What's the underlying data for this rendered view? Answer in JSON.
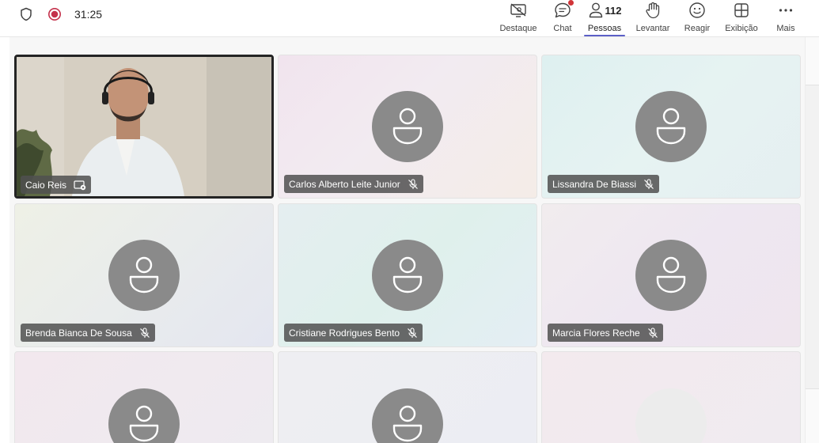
{
  "meeting": {
    "elapsed_time": "31:25"
  },
  "toolbar": {
    "spotlight_label": "Destaque",
    "chat_label": "Chat",
    "people_label": "Pessoas",
    "people_count": "112",
    "raise_label": "Levantar",
    "react_label": "Reagir",
    "view_label": "Exibição",
    "more_label": "Mais"
  },
  "participants": [
    {
      "name": "Caio Reis",
      "video": true,
      "muted": false,
      "pinned": true
    },
    {
      "name": "Carlos Alberto Leite Junior",
      "video": false,
      "muted": true
    },
    {
      "name": "Lissandra De Biassi",
      "video": false,
      "muted": true
    },
    {
      "name": "Brenda Bianca De Sousa",
      "video": false,
      "muted": true
    },
    {
      "name": "Cristiane Rodrigues Bento",
      "video": false,
      "muted": true
    },
    {
      "name": "Marcia Flores Reche",
      "video": false,
      "muted": true
    }
  ],
  "colors": {
    "accent": "#5b5fc7",
    "recording": "#c4314b",
    "notification": "#d13438",
    "avatar": "#8a8a8a"
  }
}
